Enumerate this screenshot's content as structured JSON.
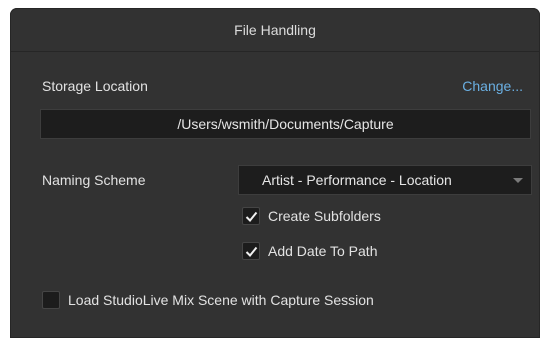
{
  "dialog": {
    "title": "File Handling"
  },
  "storage": {
    "label": "Storage Location",
    "change_label": "Change...",
    "path": "/Users/wsmith/Documents/Capture"
  },
  "naming": {
    "label": "Naming Scheme",
    "selected": "Artist - Performance - Location",
    "arrow_icon": "chevron-down-icon"
  },
  "options": {
    "create_subfolders": {
      "label": "Create Subfolders",
      "checked": true
    },
    "add_date_to_path": {
      "label": "Add Date To Path",
      "checked": true
    },
    "load_studiolive": {
      "label": "Load StudioLive Mix Scene with Capture Session",
      "checked": false
    }
  },
  "colors": {
    "background": "#323232",
    "field": "#1d1d1d",
    "link": "#6aafe2",
    "text": "#e2e2e2"
  }
}
